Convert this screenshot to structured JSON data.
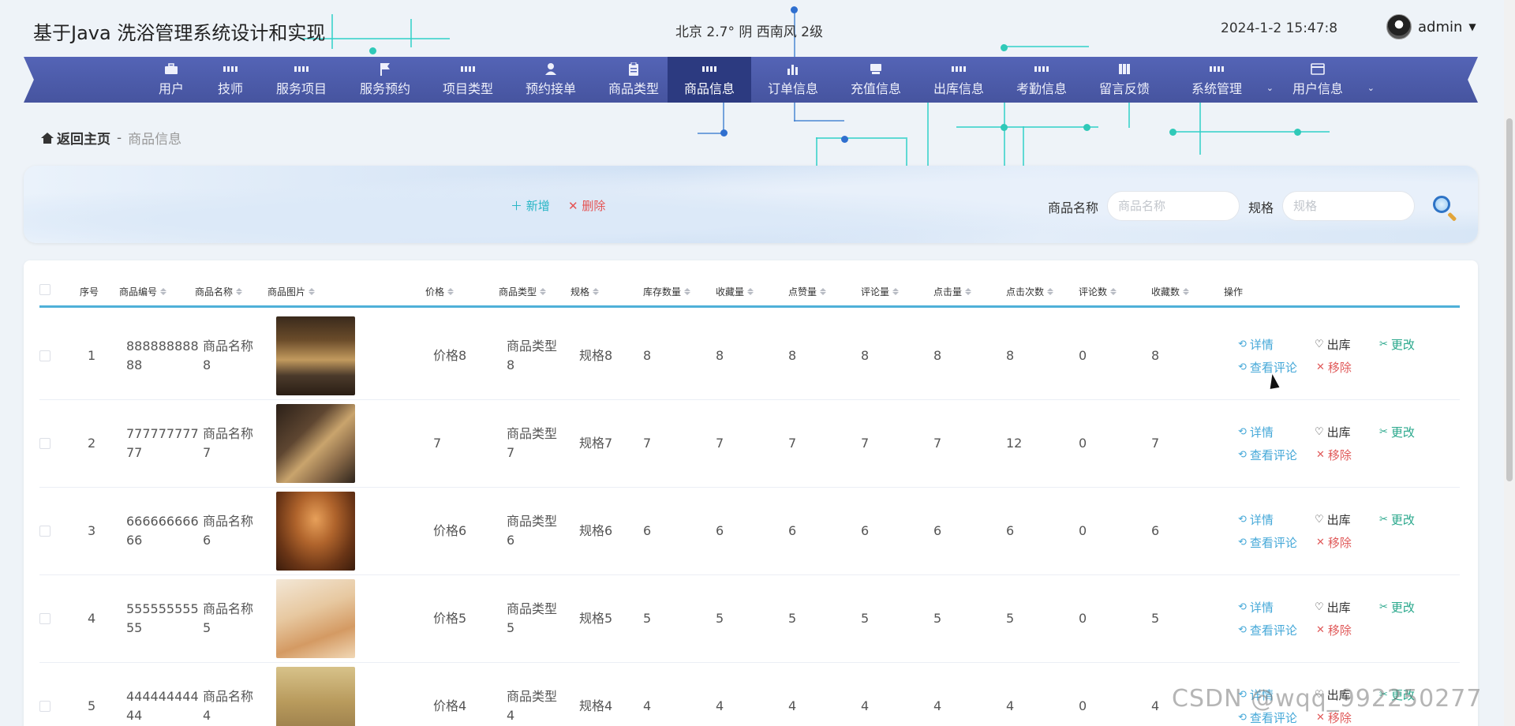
{
  "app": {
    "title": "基于Java 洗浴管理系统设计和实现",
    "weather": "北京  2.7°  阴  西南风  2级",
    "datetime": "2024-1-2 15:47:8",
    "user": "admin"
  },
  "nav": {
    "items": [
      {
        "label": "用户",
        "icon": "briefcase-icon"
      },
      {
        "label": "技师",
        "icon": "grid-icon"
      },
      {
        "label": "服务项目",
        "icon": "grid-icon"
      },
      {
        "label": "服务预约",
        "icon": "flag-icon"
      },
      {
        "label": "项目类型",
        "icon": "grid-icon"
      },
      {
        "label": "预约接单",
        "icon": "person-icon"
      },
      {
        "label": "商品类型",
        "icon": "clipboard-icon"
      },
      {
        "label": "商品信息",
        "icon": "grid-icon",
        "active": true
      },
      {
        "label": "订单信息",
        "icon": "bar-chart-icon"
      },
      {
        "label": "充值信息",
        "icon": "card-icon"
      },
      {
        "label": "出库信息",
        "icon": "grid-icon"
      },
      {
        "label": "考勤信息",
        "icon": "grid-icon"
      },
      {
        "label": "留言反馈",
        "icon": "book-icon"
      },
      {
        "label": "系统管理",
        "icon": "grid-icon"
      },
      {
        "label": "用户信息",
        "icon": "wallet-icon"
      }
    ]
  },
  "breadcrumb": {
    "home": "返回主页",
    "separator": "-",
    "current": "商品信息"
  },
  "search": {
    "add_label": "新增",
    "delete_label": "删除",
    "name_label": "商品名称",
    "name_placeholder": "商品名称",
    "spec_label": "规格",
    "spec_placeholder": "规格"
  },
  "table": {
    "headers": [
      "序号",
      "商品编号",
      "商品名称",
      "商品图片",
      "价格",
      "商品类型",
      "规格",
      "库存数量",
      "收藏量",
      "点赞量",
      "评论量",
      "点击量",
      "点击次数",
      "评论数",
      "收藏数",
      "操作"
    ],
    "actions": {
      "detail": "详情",
      "out": "出库",
      "edit": "更改",
      "comment": "查看评论",
      "remove": "移除"
    },
    "rows": [
      {
        "index": "1",
        "code1": "888888888",
        "code2": "88",
        "name1": "商品名称",
        "name2": "8",
        "price": "价格8",
        "type1": "商品类型",
        "type2": "8",
        "spec": "规格8",
        "stock": "8",
        "fav": "8",
        "like": "8",
        "cmt": "8",
        "clicks": "8",
        "click_times": "8",
        "cmt_num": "0",
        "fav_num": "8",
        "image": "lounge-room-photo"
      },
      {
        "index": "2",
        "code1": "777777777",
        "code2": "77",
        "name1": "商品名称",
        "name2": "7",
        "price": "7",
        "type1": "商品类型",
        "type2": "7",
        "spec": "规格7",
        "stock": "7",
        "fav": "7",
        "like": "7",
        "cmt": "7",
        "clicks": "7",
        "click_times": "12",
        "cmt_num": "0",
        "fav_num": "7",
        "image": "spa-bath-photo"
      },
      {
        "index": "3",
        "code1": "666666666",
        "code2": "66",
        "name1": "商品名称",
        "name2": "6",
        "price": "价格6",
        "type1": "商品类型",
        "type2": "6",
        "spec": "规格6",
        "stock": "6",
        "fav": "6",
        "like": "6",
        "cmt": "6",
        "clicks": "6",
        "click_times": "6",
        "cmt_num": "0",
        "fav_num": "6",
        "image": "sauna-room-photo"
      },
      {
        "index": "4",
        "code1": "555555555",
        "code2": "55",
        "name1": "商品名称",
        "name2": "5",
        "price": "价格5",
        "type1": "商品类型",
        "type2": "5",
        "spec": "规格5",
        "stock": "5",
        "fav": "5",
        "like": "5",
        "cmt": "5",
        "clicks": "5",
        "click_times": "5",
        "cmt_num": "0",
        "fav_num": "5",
        "image": "massage-photo"
      },
      {
        "index": "5",
        "code1": "444444444",
        "code2": "44",
        "name1": "商品名称",
        "name2": "4",
        "price": "价格4",
        "type1": "商品类型",
        "type2": "4",
        "spec": "规格4",
        "stock": "4",
        "fav": "4",
        "like": "4",
        "cmt": "4",
        "clicks": "4",
        "click_times": "4",
        "cmt_num": "0",
        "fav_num": "4",
        "image": "room-photo"
      }
    ]
  },
  "watermark": "CSDN @wqq_992250277",
  "colors": {
    "nav_bg": "#4f5eae",
    "nav_active": "#2c3a80",
    "accent": "#2ab6c6",
    "danger": "#e55353",
    "edit": "#2aa88c"
  }
}
